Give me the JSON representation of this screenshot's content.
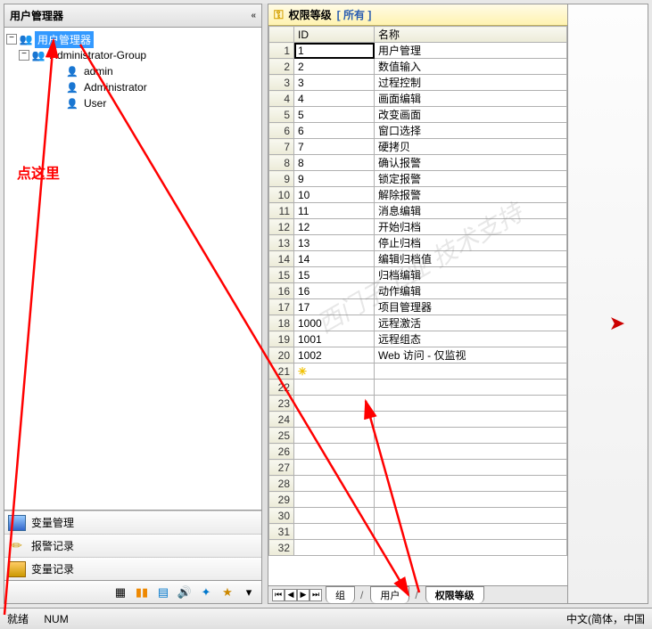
{
  "left": {
    "title": "用户管理器",
    "tree": {
      "root": "用户管理器",
      "group": "Administrator-Group",
      "users": [
        "admin",
        "Administrator",
        "User"
      ]
    },
    "annotation": "点这里",
    "sections": [
      {
        "label": "变量管理"
      },
      {
        "label": "报警记录"
      },
      {
        "label": "变量记录"
      }
    ],
    "toolbar_icons": [
      "grid",
      "bars",
      "db",
      "sound",
      "wrench",
      "star",
      "more"
    ]
  },
  "right": {
    "title_prefix": "权限等级",
    "title_suffix": "[ 所有 ]",
    "columns": {
      "id": "ID",
      "name": "名称"
    },
    "rows": [
      {
        "n": 1,
        "id": "1",
        "name": "用户管理"
      },
      {
        "n": 2,
        "id": "2",
        "name": "数值输入"
      },
      {
        "n": 3,
        "id": "3",
        "name": "过程控制"
      },
      {
        "n": 4,
        "id": "4",
        "name": "画面编辑"
      },
      {
        "n": 5,
        "id": "5",
        "name": "改变画面"
      },
      {
        "n": 6,
        "id": "6",
        "name": "窗口选择"
      },
      {
        "n": 7,
        "id": "7",
        "name": "硬拷贝"
      },
      {
        "n": 8,
        "id": "8",
        "name": "确认报警"
      },
      {
        "n": 9,
        "id": "9",
        "name": "锁定报警"
      },
      {
        "n": 10,
        "id": "10",
        "name": "解除报警"
      },
      {
        "n": 11,
        "id": "11",
        "name": "消息编辑"
      },
      {
        "n": 12,
        "id": "12",
        "name": "开始归档"
      },
      {
        "n": 13,
        "id": "13",
        "name": "停止归档"
      },
      {
        "n": 14,
        "id": "14",
        "name": "编辑归档值"
      },
      {
        "n": 15,
        "id": "15",
        "name": "归档编辑"
      },
      {
        "n": 16,
        "id": "16",
        "name": "动作编辑"
      },
      {
        "n": 17,
        "id": "17",
        "name": "项目管理器"
      },
      {
        "n": 18,
        "id": "1000",
        "name": "远程激活"
      },
      {
        "n": 19,
        "id": "1001",
        "name": "远程组态"
      },
      {
        "n": 20,
        "id": "1002",
        "name": "Web 访问 - 仅监视"
      }
    ],
    "empty_rows": [
      21,
      22,
      23,
      24,
      25,
      26,
      27,
      28,
      29,
      30,
      31,
      32
    ],
    "tabs": {
      "group": "组",
      "user": "用户",
      "perm": "权限等级"
    }
  },
  "status": {
    "ready": "就绪",
    "num": "NUM",
    "lang": "中文(简体，中国"
  }
}
